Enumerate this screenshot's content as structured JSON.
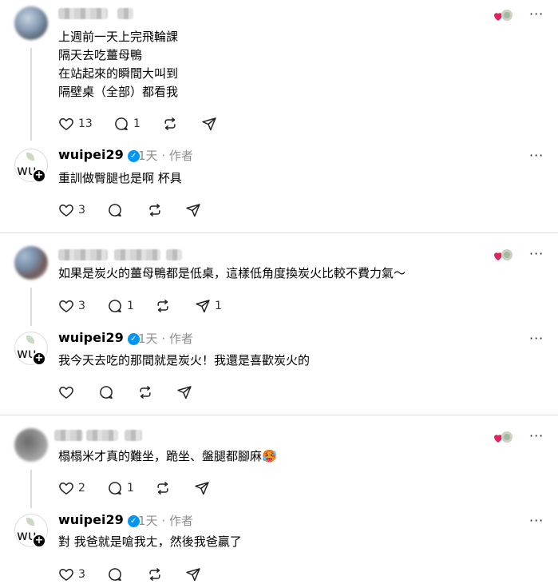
{
  "icons": [
    "heart-icon",
    "reply-icon",
    "repost-icon",
    "send-icon",
    "more-icon",
    "verified-icon"
  ],
  "threads": [
    {
      "comment": {
        "lines": [
          "上週前一天上完飛輪課",
          "隔天去吃薑母鴨",
          "在站起來的瞬間大叫到",
          "隔壁桌（全部）都看我"
        ],
        "likes": "13",
        "replies": "1",
        "sends": ""
      },
      "reply": {
        "username": "wuipei29",
        "time": "1天",
        "role": "作者",
        "text": "重訓做臀腿也是啊 杯具",
        "likes": "3"
      }
    },
    {
      "comment": {
        "lines": [
          "如果是炭火的薑母鴨都是低桌，這樣低角度換炭火比較不費力氣～"
        ],
        "likes": "3",
        "replies": "1",
        "sends": "1"
      },
      "reply": {
        "username": "wuipei29",
        "time": "1天",
        "role": "作者",
        "text": "我今天去吃的那間就是炭火！我還是喜歡炭火的",
        "likes": ""
      }
    },
    {
      "comment": {
        "lines": [
          "榻榻米才真的難坐，跪坐、盤腿都腳麻🥵"
        ],
        "likes": "2",
        "replies": "1",
        "sends": ""
      },
      "reply": {
        "username": "wuipei29",
        "time": "1天",
        "role": "作者",
        "text": "對 我爸就是嗆我ㄤ，然後我爸贏了",
        "likes": "3"
      }
    }
  ],
  "separator": "·",
  "more_glyph": "···"
}
